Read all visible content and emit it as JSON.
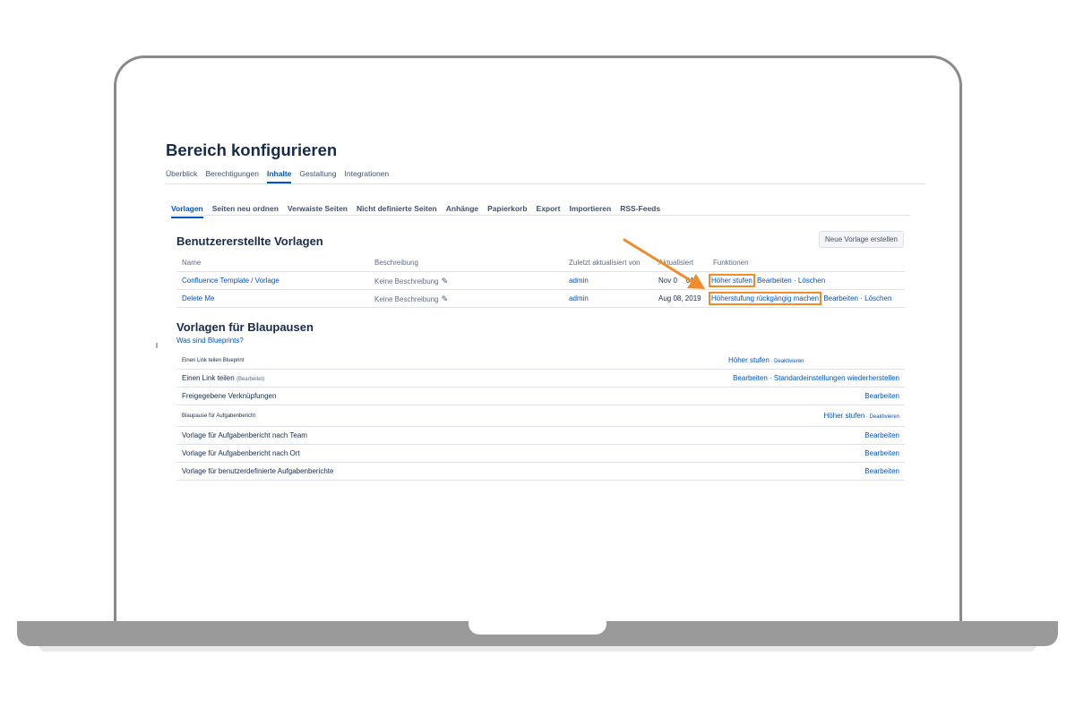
{
  "page": {
    "title": "Bereich konfigurieren"
  },
  "main_tabs": [
    {
      "label": "Überblick",
      "active": false
    },
    {
      "label": "Berechtigungen",
      "active": false
    },
    {
      "label": "Inhalte",
      "active": true
    },
    {
      "label": "Gestaltung",
      "active": false
    },
    {
      "label": "Integrationen",
      "active": false
    }
  ],
  "sub_tabs": [
    {
      "label": "Vorlagen",
      "active": true
    },
    {
      "label": "Seiten neu ordnen",
      "active": false
    },
    {
      "label": "Verwaiste Seiten",
      "active": false
    },
    {
      "label": "Nicht definierte Seiten",
      "active": false
    },
    {
      "label": "Anhänge",
      "active": false
    },
    {
      "label": "Papierkorb",
      "active": false
    },
    {
      "label": "Export",
      "active": false
    },
    {
      "label": "Importieren",
      "active": false
    },
    {
      "label": "RSS-Feeds",
      "active": false
    }
  ],
  "user_templates": {
    "title": "Benutzererstellte Vorlagen",
    "new_button": "Neue Vorlage erstellen",
    "headers": {
      "name": "Name",
      "description": "Beschreibung",
      "updated_by": "Zuletzt aktualisiert von",
      "updated": "Aktualisiert",
      "functions": "Funktionen"
    },
    "rows": [
      {
        "name": "Confluence Template / Vorlage",
        "description": "Keine Beschreibung",
        "updated_by": "admin",
        "updated": "Nov 0",
        "updated_tail": "019",
        "action_primary": "Höher stufen",
        "action_edit": "Bearbeiten",
        "sep": "·",
        "action_delete": "Löschen"
      },
      {
        "name": "Delete Me",
        "description": "Keine Beschreibung",
        "updated_by": "admin",
        "updated": "Aug 08, 2019",
        "action_primary": "Höherstufung rückgängig machen",
        "action_edit": "Bearbeiten",
        "sep": "·",
        "action_delete": "Löschen"
      }
    ]
  },
  "blueprints": {
    "title": "Vorlagen für Blaupausen",
    "subtitle": "Was sind Blueprints?",
    "rows": [
      {
        "name": "Einen Link teilen Blueprint",
        "action1": "Höher stufen",
        "sep": " · ",
        "action2": "Deaktivieren"
      },
      {
        "name": "Einen Link teilen",
        "suffix": "(Bearbeitet)",
        "action1": "Bearbeiten",
        "sep": " · ",
        "action2": "Standardeinstellungen wiederherstellen"
      },
      {
        "name": "Freigegebene Verknüpfungen",
        "action1": "Bearbeiten"
      },
      {
        "name": "Blaupause für Aufgabenbericht",
        "action1": "Höher stufen",
        "sep": " · ",
        "action2": "Deaktivieren"
      },
      {
        "name": "Vorlage für Aufgabenbericht nach Team",
        "action1": "Bearbeiten"
      },
      {
        "name": "Vorlage für Aufgabenbericht nach Ort",
        "action1": "Bearbeiten"
      },
      {
        "name": "Vorlage für benutzerdefinierte Aufgabenberichte",
        "action1": "Bearbeiten"
      }
    ]
  },
  "colors": {
    "link": "#0052cc",
    "highlight": "#f08c2a",
    "text": "#172b4d"
  }
}
